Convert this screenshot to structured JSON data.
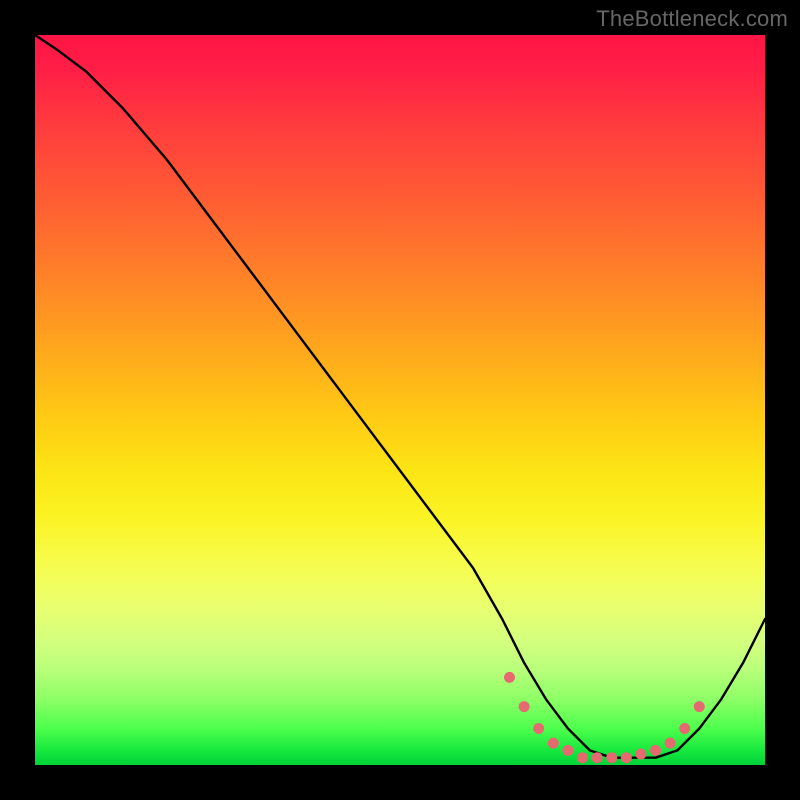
{
  "watermark": "TheBottleneck.com",
  "colors": {
    "curve": "#000000",
    "marker_fill": "#e46a6f",
    "marker_stroke": "#e46a6f"
  },
  "chart_data": {
    "type": "line",
    "title": "",
    "xlabel": "",
    "ylabel": "",
    "xlim": [
      0,
      100
    ],
    "ylim": [
      0,
      100
    ],
    "grid": false,
    "legend": false,
    "series": [
      {
        "name": "bottleneck-curve",
        "x": [
          0,
          3,
          7,
          12,
          18,
          24,
          30,
          36,
          42,
          48,
          54,
          60,
          64,
          67,
          70,
          73,
          76,
          79,
          82,
          85,
          88,
          91,
          94,
          97,
          100
        ],
        "y": [
          100,
          98,
          95,
          90,
          83,
          75,
          67,
          59,
          51,
          43,
          35,
          27,
          20,
          14,
          9,
          5,
          2,
          1,
          1,
          1,
          2,
          5,
          9,
          14,
          20
        ]
      }
    ],
    "markers": {
      "name": "highlight-points",
      "x": [
        65,
        67,
        69,
        71,
        73,
        75,
        77,
        79,
        81,
        83,
        85,
        87,
        89,
        91
      ],
      "y": [
        12,
        8,
        5,
        3,
        2,
        1,
        1,
        1,
        1,
        1.5,
        2,
        3,
        5,
        8
      ]
    }
  }
}
